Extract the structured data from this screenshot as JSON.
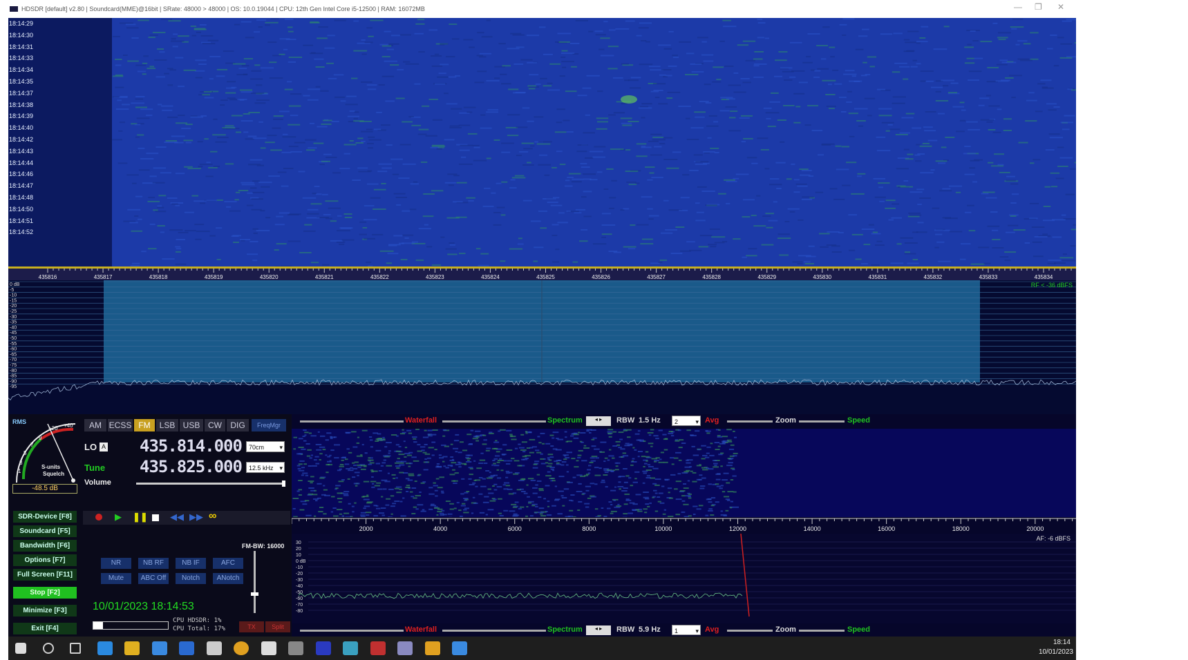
{
  "titlebar": {
    "title": "HDSDR [default] v2.80  |  Soundcard(MME)@16bit  |  SRate: 48000 > 48000  |  OS: 10.0.19044  |  CPU: 12th Gen Intel Core i5-12500  |  RAM: 16072MB"
  },
  "waterfall_times": [
    "18:14:29",
    "18:14:30",
    "18:14:31",
    "18:14:33",
    "18:14:34",
    "18:14:35",
    "18:14:37",
    "18:14:38",
    "18:14:39",
    "18:14:40",
    "18:14:42",
    "18:14:43",
    "18:14:44",
    "18:14:46",
    "18:14:47",
    "18:14:48",
    "18:14:50",
    "18:14:51",
    "18:14:52"
  ],
  "freq_ticks": [
    "435816",
    "435817",
    "435818",
    "435819",
    "435820",
    "435821",
    "435822",
    "435823",
    "435824",
    "435825",
    "435826",
    "435827",
    "435828",
    "435829",
    "435830",
    "435831",
    "435832",
    "435833",
    "435834"
  ],
  "spectrum": {
    "db_labels": [
      "0 dB",
      "-5",
      "-10",
      "-15",
      "-20",
      "-25",
      "-30",
      "-35",
      "-40",
      "-45",
      "-50",
      "-55",
      "-60",
      "-65",
      "-70",
      "-75",
      "-80",
      "-85",
      "-90",
      "-95"
    ],
    "rf_label": "RF < -36 dBFS"
  },
  "smeter": {
    "rms_label": "RMS",
    "scale_top": "+20",
    "scale_plus40": "+40",
    "scale_labels": [
      "1",
      "3",
      "5",
      "7",
      "9"
    ],
    "caption_1": "S-units",
    "caption_2": "Squelch",
    "readout": "-48.5 dB"
  },
  "modes": [
    "AM",
    "ECSS",
    "FM",
    "LSB",
    "USB",
    "CW",
    "DIG"
  ],
  "active_mode": "FM",
  "freqmgr_label": "FreqMgr",
  "lo": {
    "label": "LO",
    "badge": "A",
    "freq": "435.814.000",
    "band": "70cm"
  },
  "tune": {
    "label": "Tune",
    "freq": "435.825.000",
    "step": "12.5 kHz"
  },
  "volume_label": "Volume",
  "function_buttons": [
    "SDR-Device [F8]",
    "Soundcard  [F5]",
    "Bandwidth  [F6]",
    "Options   [F7]",
    "Full Screen [F11]",
    "Stop        [F2]",
    "Minimize [F3]",
    "Exit       [F4]"
  ],
  "fm_bw": "FM-BW: 16000",
  "dsp_row1": [
    "NR",
    "NB RF",
    "NB IF",
    "AFC"
  ],
  "dsp_row2": [
    "Mute",
    "ABC Off",
    "Notch",
    "ANotch"
  ],
  "datetime": "10/01/2023 18:14:53",
  "cpu_hdsdr": "CPU HDSDR:  1%",
  "cpu_total": "CPU Total: 17%",
  "tx_label": "TX",
  "split_label": "Split",
  "toolbar_top": {
    "waterfall": "Waterfall",
    "spectrum": "Spectrum",
    "rbw_label": "RBW",
    "rbw_value": "1.5 Hz",
    "avg_value": "2",
    "avg_label": "Avg",
    "zoom_label": "Zoom",
    "speed_label": "Speed"
  },
  "toolbar_bottom": {
    "waterfall": "Waterfall",
    "spectrum": "Spectrum",
    "rbw_label": "RBW",
    "rbw_value": "5.9 Hz",
    "avg_value": "1",
    "avg_label": "Avg",
    "zoom_label": "Zoom",
    "speed_label": "Speed"
  },
  "af_ticks": [
    "2000",
    "4000",
    "6000",
    "8000",
    "10000",
    "12000",
    "14000",
    "16000",
    "18000",
    "20000"
  ],
  "af_label": "AF: -6 dBFS",
  "af_db_labels": [
    "30",
    "20",
    "10",
    "0 dB",
    "-10",
    "-20",
    "-30",
    "-40",
    "-50",
    "-60",
    "-70",
    "-80"
  ],
  "taskbar": {
    "icons": [
      "windows-start-icon",
      "search-icon",
      "task-view-icon",
      "edge-icon",
      "file-explorer-icon",
      "store-icon",
      "mail-icon",
      "settings-icon",
      "chrome-icon",
      "app-icon-1",
      "app-icon-2",
      "app-icon-3",
      "app-icon-4",
      "app-icon-5",
      "app-icon-6",
      "app-icon-7",
      "app-icon-8"
    ],
    "time": "18:14",
    "date": "10/01/2023"
  },
  "colors": {
    "waterfall_blue": "#1c3aa8",
    "passband": "#1a5a8a",
    "active_mode": "#c8a020",
    "function_green": "#103818",
    "stop_green": "#20c020",
    "digits": "#dde"
  }
}
